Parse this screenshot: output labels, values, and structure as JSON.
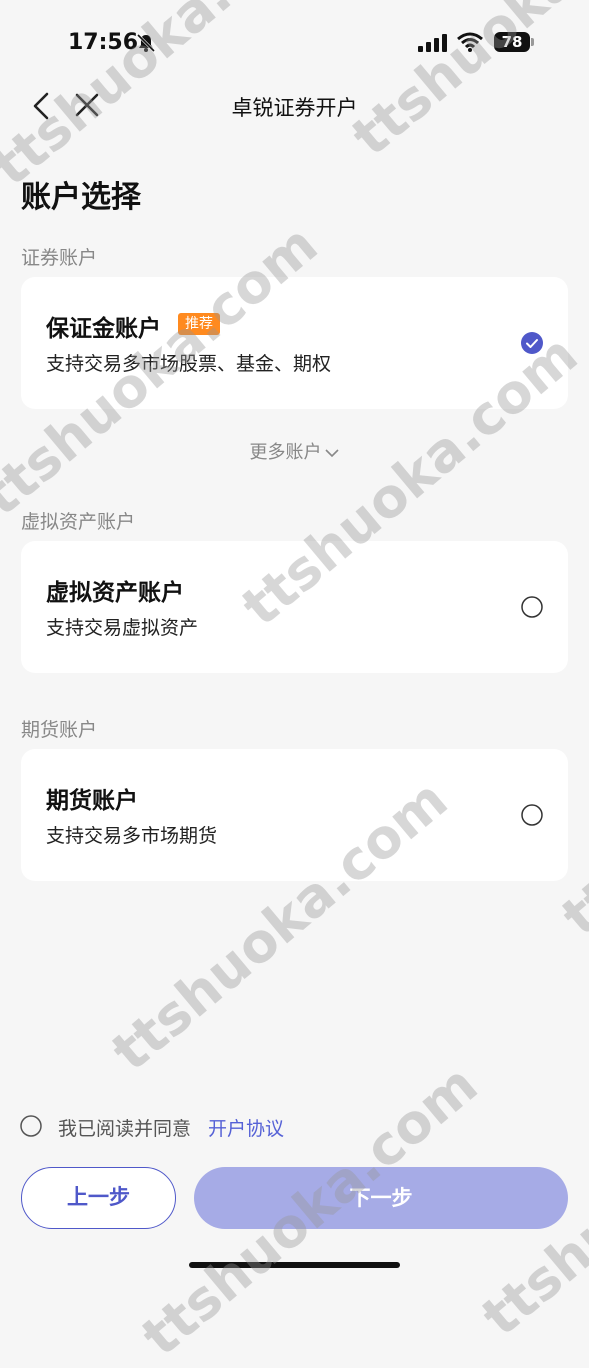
{
  "status_bar": {
    "time": "17:56",
    "battery": "78"
  },
  "nav": {
    "title": "卓锐证券开户"
  },
  "page_title": "账户选择",
  "sections": {
    "securities": {
      "label": "证券账户",
      "card": {
        "title": "保证金账户",
        "badge": "推荐",
        "desc": "支持交易多市场股票、基金、期权",
        "selected": true
      }
    },
    "more": {
      "label": "更多账户"
    },
    "virtual": {
      "label": "虚拟资产账户",
      "card": {
        "title": "虚拟资产账户",
        "desc": "支持交易虚拟资产",
        "selected": false
      }
    },
    "futures": {
      "label": "期货账户",
      "card": {
        "title": "期货账户",
        "desc": "支持交易多市场期货",
        "selected": false
      }
    }
  },
  "agreement": {
    "text": "我已阅读并同意",
    "link": "开户协议",
    "checked": false
  },
  "buttons": {
    "prev": "上一步",
    "next": "下一步"
  },
  "watermark": "ttshuoka.com",
  "colors": {
    "accent": "#4f58c9",
    "next_disabled": "#a6abe6",
    "badge": "#ff8a1f",
    "background": "#f6f6f6"
  }
}
